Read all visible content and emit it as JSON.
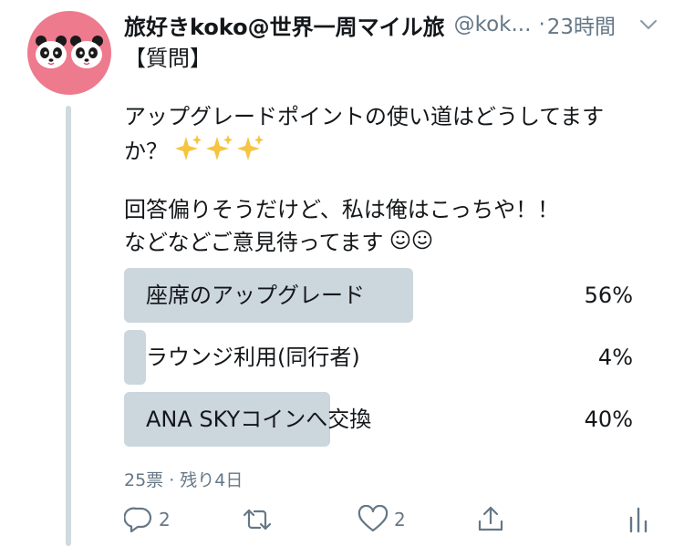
{
  "tweet": {
    "display_name": "旅好きkoko@世界一周マイル旅",
    "handle": "@kok...",
    "dot": "·",
    "timestamp": "23時間",
    "avatar_icon": "panda-avatar-icon",
    "lines": [
      "【質問】",
      "アップグレードポイントの使い道はどうしてます",
      "か？",
      "回答偏りそうだけど、私は俺はこっちや！！",
      "などなどご意見待ってます"
    ]
  },
  "poll": {
    "options": [
      {
        "label": "座席のアップグレード",
        "percent_text": "56%",
        "percent": 56
      },
      {
        "label": "ラウンジ利用(同行者)",
        "percent_text": "4%",
        "percent": 4
      },
      {
        "label": "ANA SKYコインへ交換",
        "percent_text": "40%",
        "percent": 40
      }
    ],
    "meta": "25票 · 残り4日"
  },
  "actions": {
    "reply": {
      "icon": "reply-icon",
      "count": "2"
    },
    "retweet": {
      "icon": "retweet-icon",
      "count": ""
    },
    "like": {
      "icon": "heart-icon",
      "count": "2"
    },
    "share": {
      "icon": "share-icon"
    },
    "analytics": {
      "icon": "analytics-icon"
    }
  },
  "colors": {
    "avatar_bg": "#ee7a8d",
    "poll_bar": "#ccd6dd",
    "muted_text": "#657786",
    "thread_line": "#cfd9de",
    "sparkle": "#f5c542"
  }
}
